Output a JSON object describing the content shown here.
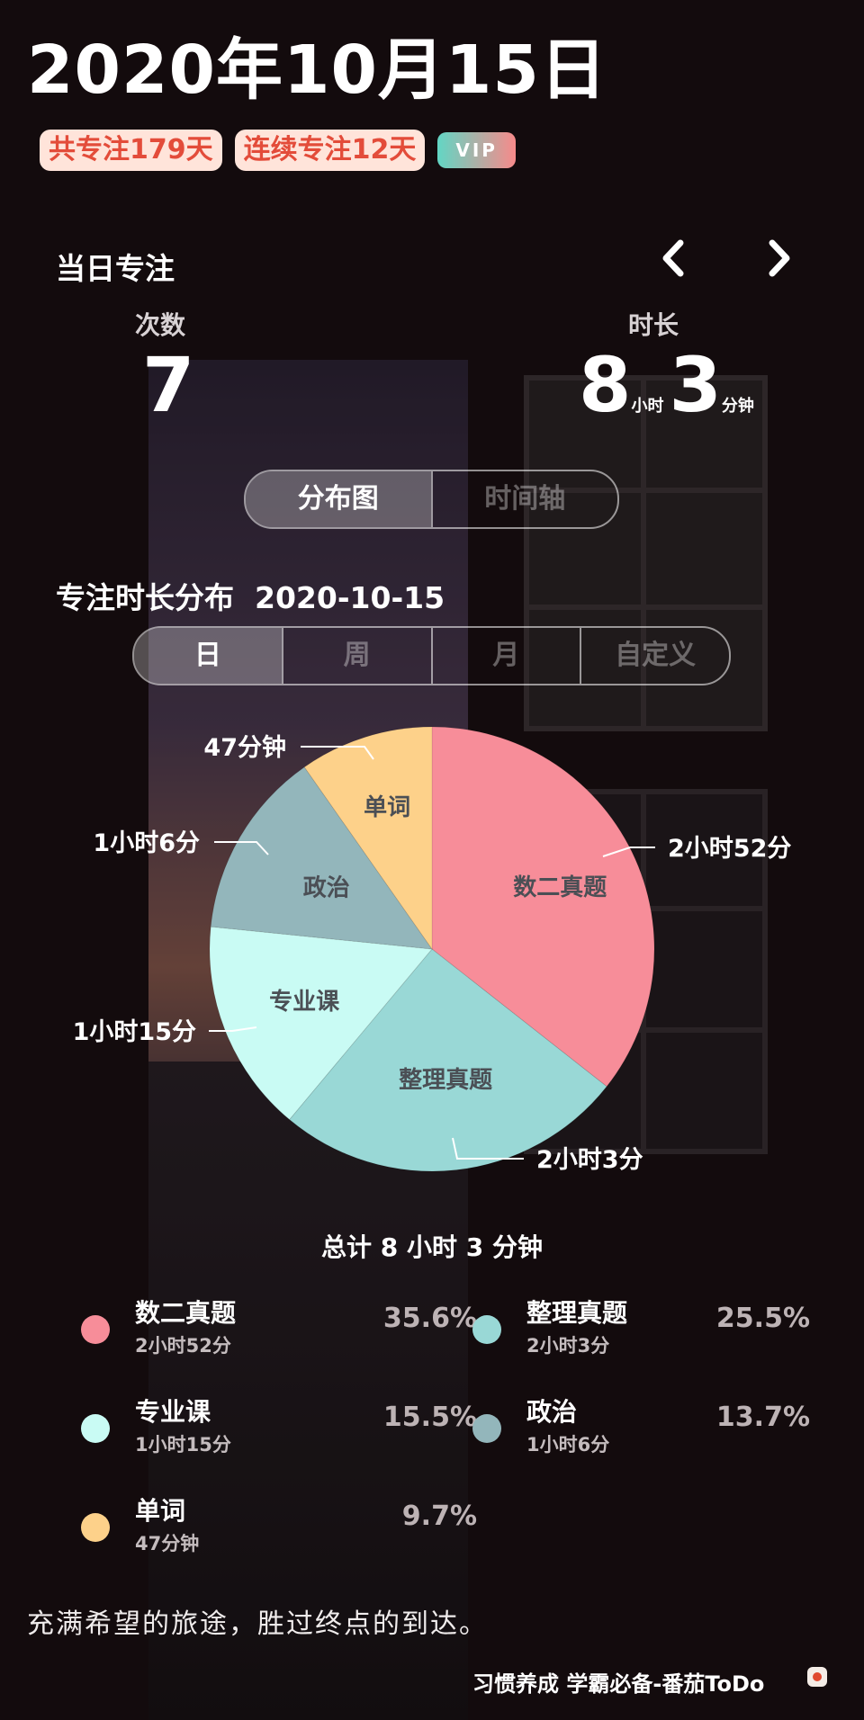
{
  "header": {
    "date": "2020年10月15日",
    "badge_total": "共专注179天",
    "badge_streak": "连续专注12天",
    "vip": "VIP"
  },
  "daily": {
    "title": "当日专注",
    "count_label": "次数",
    "count_value": "7",
    "duration_label": "时长",
    "hours": "8",
    "hours_unit": "小时",
    "minutes": "3",
    "minutes_unit": "分钟"
  },
  "view_toggle": {
    "distribution": "分布图",
    "timeline": "时间轴"
  },
  "distribution": {
    "title": "专注时长分布",
    "date": "2020-10-15",
    "ranges": [
      "日",
      "周",
      "月",
      "自定义"
    ]
  },
  "chart_data": {
    "type": "pie",
    "slices": [
      {
        "name": "数二真题",
        "duration": "2小时52分",
        "duration_legend": "2小时52分",
        "minutes": 172,
        "percent": "35.6%",
        "color": "#f78d99"
      },
      {
        "name": "整理真题",
        "duration": "2小时3分",
        "duration_legend": "2小时3分",
        "minutes": 123,
        "percent": "25.5%",
        "color": "#99d8d6"
      },
      {
        "name": "专业课",
        "duration": "1小时15分",
        "duration_legend": "1小时15分",
        "minutes": 75,
        "percent": "15.5%",
        "color": "#c9fbf4"
      },
      {
        "name": "政治",
        "duration": "1小时6分",
        "duration_legend": "1小时6分",
        "minutes": 66,
        "percent": "13.7%",
        "color": "#93b6bb"
      },
      {
        "name": "单词",
        "duration": "47分钟",
        "duration_legend": "47分钟",
        "minutes": 47,
        "percent": "9.7%",
        "color": "#fdd18a"
      }
    ],
    "total": "总计 8 小时 3 分钟"
  },
  "quote": "充满希望的旅途，胜过终点的到达。",
  "footer": "习惯养成 学霸必备-番茄ToDo"
}
